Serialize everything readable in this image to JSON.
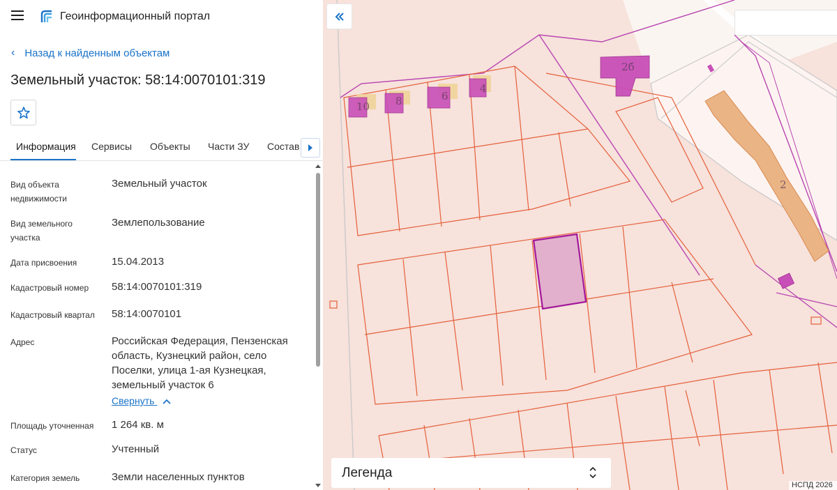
{
  "app": {
    "title": "Геоинформационный портал"
  },
  "nav": {
    "back_label": "Назад к найденным объектам"
  },
  "page": {
    "title": "Земельный участок: 58:14:0070101:319"
  },
  "tabs": [
    "Информация",
    "Сервисы",
    "Объекты",
    "Части ЗУ",
    "Состав"
  ],
  "info": [
    {
      "label": "Вид объекта недвижимости",
      "value": "Земельный участок"
    },
    {
      "label": "Вид земельного участка",
      "value": "Землепользование"
    },
    {
      "label": "Дата присвоения",
      "value": "15.04.2013"
    },
    {
      "label": "Кадастровый номер",
      "value": "58:14:0070101:319"
    },
    {
      "label": "Кадастровый квартал",
      "value": "58:14:0070101"
    },
    {
      "label": "Адрес",
      "value": "Российская Федерация, Пензенская область, Кузнецкий район, село Поселки, улица 1-ая Кузнецкая, земельный участок 6"
    },
    {
      "label": "Площадь уточненная",
      "value": "1 264 кв. м"
    },
    {
      "label": "Статус",
      "value": "Учтенный"
    },
    {
      "label": "Категория земель",
      "value": "Земли населенных пунктов"
    }
  ],
  "address_toggle": "Свернуть",
  "map": {
    "legend_label": "Легенда",
    "attribution": "НСПД 2026",
    "building_labels": [
      "10",
      "8",
      "6",
      "4",
      "2б",
      "2"
    ]
  },
  "colors": {
    "accent": "#1a73c8",
    "parcel_line": "#e5603a",
    "selected": "#a3179b",
    "building": "#c94fb8",
    "map_bg": "#f7e2dc"
  },
  "icons": [
    "menu-icon",
    "portal-logo-icon",
    "chevron-left-icon",
    "star-icon",
    "chevron-right-icon",
    "chevron-up-icon",
    "double-chevron-left-icon",
    "sort-updown-icon"
  ]
}
